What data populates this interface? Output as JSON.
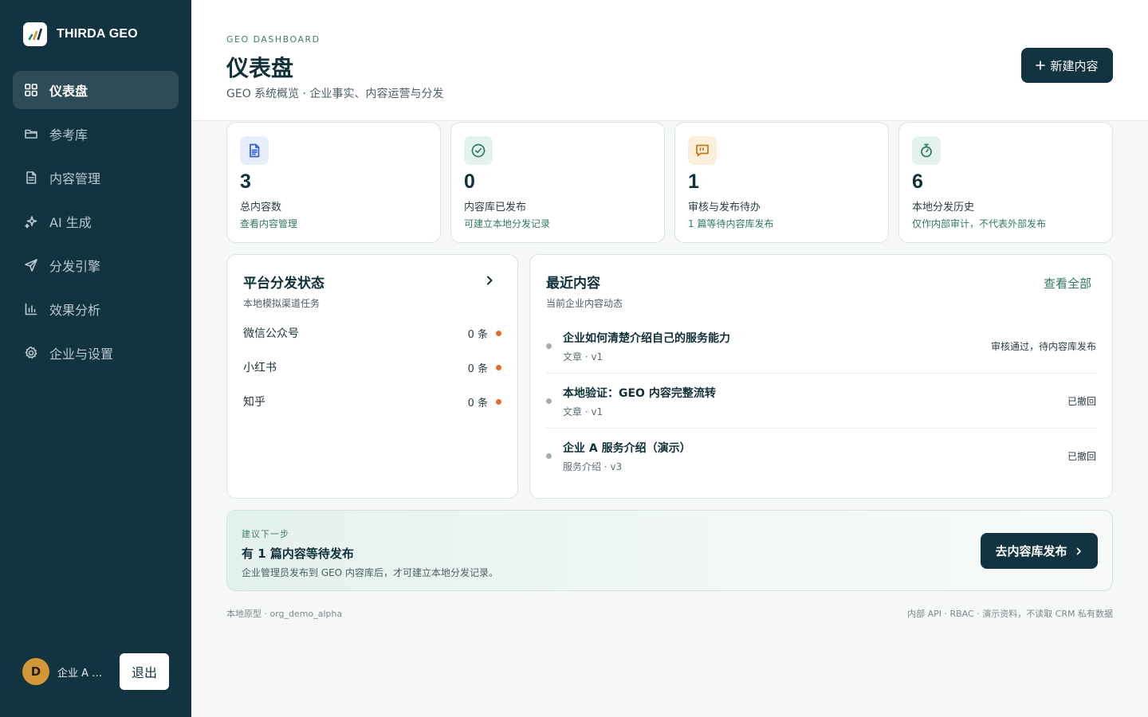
{
  "brand": {
    "name": "THIRDA GEO"
  },
  "sidebar": {
    "items": [
      {
        "label": "仪表盘",
        "icon": "dashboard-grid-icon",
        "active": true
      },
      {
        "label": "参考库",
        "icon": "folder-icon"
      },
      {
        "label": "内容管理",
        "icon": "document-icon"
      },
      {
        "label": "AI 生成",
        "icon": "sparkles-icon"
      },
      {
        "label": "分发引擎",
        "icon": "send-icon"
      },
      {
        "label": "效果分析",
        "icon": "bar-chart-icon"
      },
      {
        "label": "企业与设置",
        "icon": "gear-icon"
      }
    ]
  },
  "user": {
    "initial": "D",
    "name": "企业 A 管...",
    "logout_label": "退出"
  },
  "header": {
    "eyebrow": "GEO DASHBOARD",
    "title": "仪表盘",
    "subtitle": "GEO 系统概览 · 企业事实、内容运营与分发",
    "new_button_label": "新建内容"
  },
  "stats": [
    {
      "value": "3",
      "label": "总内容数",
      "link": "查看内容管理",
      "icon": "document-icon",
      "icon_color": "#2f5fd8",
      "icon_bg": "#e6eefc"
    },
    {
      "value": "0",
      "label": "内容库已发布",
      "link": "可建立本地分发记录",
      "icon": "check-circle-icon",
      "icon_color": "#2f7a62",
      "icon_bg": "#e3f3ec"
    },
    {
      "value": "1",
      "label": "审核与发布待办",
      "link": "1 篇等待内容库发布",
      "icon": "message-icon",
      "icon_color": "#c07a1a",
      "icon_bg": "#fbeedb"
    },
    {
      "value": "6",
      "label": "本地分发历史",
      "link": "仅作内部审计，不代表外部发布",
      "icon": "stopwatch-icon",
      "icon_color": "#2f7a62",
      "icon_bg": "#e3f3ec"
    }
  ],
  "platforms": {
    "title": "平台分发状态",
    "subtitle": "本地模拟渠道任务",
    "items": [
      {
        "name": "微信公众号",
        "count": "0 条",
        "status_color": "#e86a2e"
      },
      {
        "name": "小红书",
        "count": "0 条",
        "status_color": "#e86a2e"
      },
      {
        "name": "知乎",
        "count": "0 条",
        "status_color": "#e86a2e"
      }
    ]
  },
  "recent": {
    "title": "最近内容",
    "subtitle": "当前企业内容动态",
    "view_all": "查看全部",
    "items": [
      {
        "title": "企业如何清楚介绍自己的服务能力",
        "meta": "文章 · v1",
        "status": "审核通过，待内容库发布"
      },
      {
        "title": "本地验证：GEO 内容完整流转",
        "meta": "文章 · v1",
        "status": "已撤回"
      },
      {
        "title": "企业 A 服务介绍（演示）",
        "meta": "服务介绍 · v3",
        "status": "已撤回"
      }
    ]
  },
  "suggestion": {
    "eyebrow": "建议下一步",
    "title": "有 1 篇内容等待发布",
    "desc": "企业管理员发布到 GEO 内容库后，才可建立本地分发记录。",
    "button_label": "去内容库发布"
  },
  "footer": {
    "left": "本地原型 · org_demo_alpha",
    "right": "内部 API · RBAC · 演示资料，不读取 CRM 私有数据"
  },
  "colors": {
    "sidebar_bg": "#123340",
    "accent": "#2f7a62",
    "primary_button": "#123340",
    "warning_dot": "#e86a2e"
  }
}
